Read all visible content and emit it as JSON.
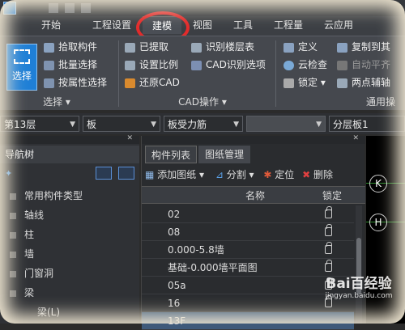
{
  "menu": {
    "tabs": [
      {
        "label": "开始"
      },
      {
        "label": "工程设置"
      },
      {
        "label": "建模"
      },
      {
        "label": "视图"
      },
      {
        "label": "工具"
      },
      {
        "label": "工程量"
      },
      {
        "label": "云应用"
      }
    ]
  },
  "ribbon": {
    "select": {
      "big_button": "选择",
      "group_label": "选择",
      "items": [
        "拾取构件",
        "批量选择",
        "按属性选择"
      ]
    },
    "cad": {
      "group_label": "CAD操作",
      "col1": [
        "已提取",
        "设置比例",
        "还原CAD"
      ],
      "col2": [
        "识别楼层表",
        "CAD识别选项"
      ]
    },
    "general": {
      "group_label": "通用操",
      "col1": [
        "定义",
        "云检查",
        "锁定"
      ],
      "col2": [
        "复制到其",
        "自动平齐",
        "两点辅轴"
      ]
    }
  },
  "filters": {
    "floor": "第13层",
    "category": "板",
    "subtype": "板受力筋",
    "empty": "",
    "layer": "分层板1"
  },
  "nav": {
    "title": "导航树",
    "items": [
      "常用构件类型",
      "轴线",
      "柱",
      "墙",
      "门窗洞",
      "梁",
      "梁(L)"
    ]
  },
  "components": {
    "tabs": [
      "构件列表",
      "图纸管理"
    ],
    "toolbar": {
      "add": "添加图纸",
      "split": "分割",
      "locate": "定位",
      "delete": "删除"
    },
    "columns": {
      "name": "名称",
      "lock": "锁定"
    },
    "rows": [
      "02",
      "08",
      "0.000-5.8墙",
      "基础-0.000墙平面图",
      "05a",
      "16",
      "13F"
    ]
  },
  "axis_labels": [
    "K",
    "H"
  ],
  "watermark": {
    "brand": "Bai百经验",
    "url": "jingyan.baidu.com"
  }
}
